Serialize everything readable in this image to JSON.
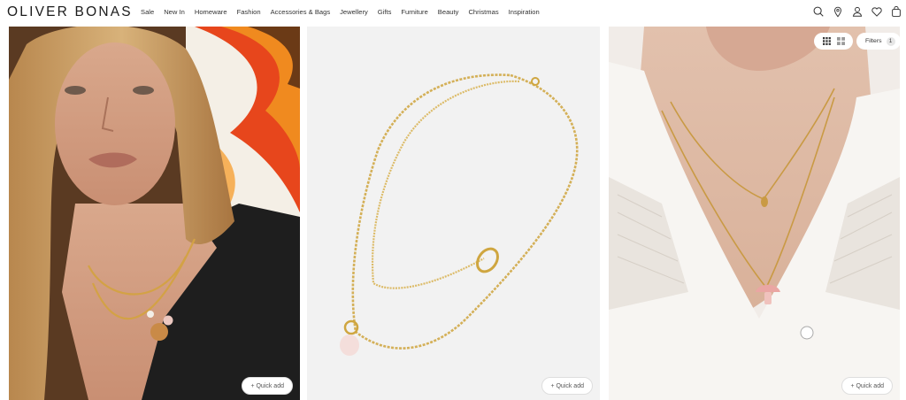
{
  "header": {
    "logo": "OLIVER BONAS",
    "nav": [
      "Sale",
      "New In",
      "Homeware",
      "Fashion",
      "Accessories & Bags",
      "Jewellery",
      "Gifts",
      "Furniture",
      "Beauty",
      "Christmas",
      "Inspiration"
    ],
    "icons": [
      "search-icon",
      "location-icon",
      "account-icon",
      "wishlist-icon",
      "bag-icon"
    ]
  },
  "controls": {
    "filters_label": "Filters",
    "filters_count": "1",
    "view_icons": [
      "grid-large-icon",
      "grid-small-icon"
    ]
  },
  "products": [
    {
      "quick_add": "+ Quick add"
    },
    {
      "quick_add": "+ Quick add"
    },
    {
      "quick_add": "+ Quick add"
    }
  ]
}
